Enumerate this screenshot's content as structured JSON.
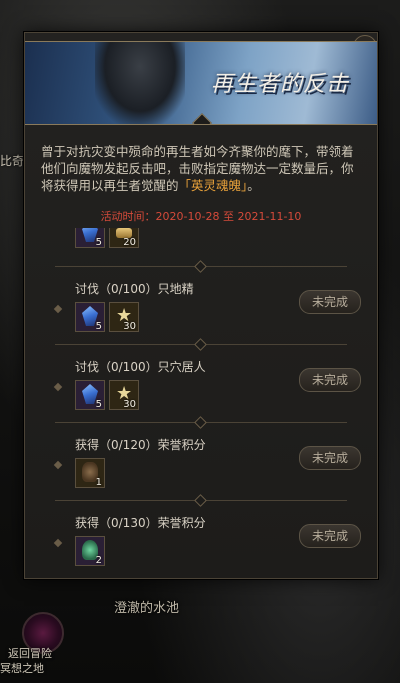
{
  "background": {
    "left_text": "比奇",
    "pool_label": "澄澈的水池",
    "return_label": "返回冒险",
    "map_label": "冥想之地"
  },
  "banner": {
    "title": "再生者的反击"
  },
  "description": {
    "text": "曾于对抗灾变中殒命的再生者如今齐聚你的麾下，带领着他们向魔物发起反击吧，击败指定魔物达一定数量后，你将获得用以再生者觉醒的",
    "highlight": "「英灵魂魄」",
    "suffix": "。"
  },
  "activity_time": "活动时间：2020-10-28 至 2021-11-10",
  "tasks": [
    {
      "title": "",
      "status": "",
      "rewards": [
        {
          "icon": "crystal-icon",
          "qty": "5"
        },
        {
          "icon": "gold-icon",
          "qty": "20"
        }
      ]
    },
    {
      "title": "讨伐（0/100）只地精",
      "status": "未完成",
      "rewards": [
        {
          "icon": "crystal-icon",
          "qty": "5"
        },
        {
          "icon": "star-icon",
          "qty": "30"
        }
      ]
    },
    {
      "title": "讨伐（0/100）只穴居人",
      "status": "未完成",
      "rewards": [
        {
          "icon": "crystal-icon",
          "qty": "5"
        },
        {
          "icon": "star-icon",
          "qty": "30"
        }
      ]
    },
    {
      "title": "获得（0/120）荣誉积分",
      "status": "未完成",
      "rewards": [
        {
          "icon": "bag-icon",
          "qty": "1"
        }
      ]
    },
    {
      "title": "获得（0/130）荣誉积分",
      "status": "未完成",
      "rewards": [
        {
          "icon": "potion-icon",
          "qty": "2"
        }
      ]
    }
  ]
}
